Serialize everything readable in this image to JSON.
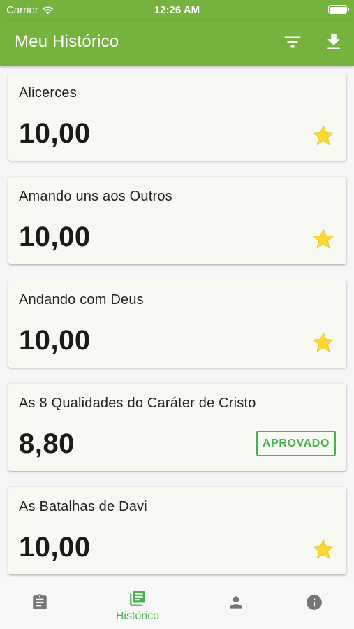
{
  "status_bar": {
    "carrier": "Carrier",
    "time": "12:26 AM"
  },
  "app_bar": {
    "title": "Meu Histórico",
    "actions": [
      "filter-icon",
      "download-icon"
    ]
  },
  "records": [
    {
      "title": "Alicerces",
      "grade": "10,00",
      "indicator": "star"
    },
    {
      "title": "Amando uns aos Outros",
      "grade": "10,00",
      "indicator": "star"
    },
    {
      "title": "Andando com Deus",
      "grade": "10,00",
      "indicator": "star"
    },
    {
      "title": "As 8 Qualidades do Caráter de Cristo",
      "grade": "8,80",
      "indicator": "badge",
      "badge_label": "APROVADO"
    },
    {
      "title": "As Batalhas de Davi",
      "grade": "10,00",
      "indicator": "star"
    }
  ],
  "bottom_nav": {
    "items": [
      {
        "icon": "clipboard-icon",
        "label": ""
      },
      {
        "icon": "history-icon",
        "label": "Histórico",
        "active": true
      },
      {
        "icon": "person-icon",
        "label": ""
      },
      {
        "icon": "info-icon",
        "label": ""
      }
    ]
  },
  "colors": {
    "primary": "#76b33e",
    "active_nav": "#4caf50",
    "inactive_nav": "#757575",
    "star": "#fdd835",
    "badge": "#4caf50",
    "card_bg": "#f6f9f2"
  }
}
